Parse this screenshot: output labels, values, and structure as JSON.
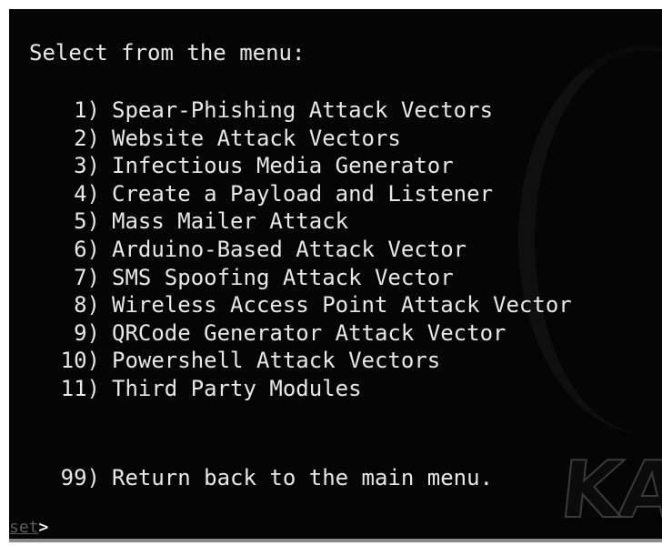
{
  "terminal": {
    "heading": "Select from the menu:",
    "menu_items": [
      {
        "number": "1)",
        "label": "Spear-Phishing Attack Vectors"
      },
      {
        "number": "2)",
        "label": "Website Attack Vectors"
      },
      {
        "number": "3)",
        "label": "Infectious Media Generator"
      },
      {
        "number": "4)",
        "label": "Create a Payload and Listener"
      },
      {
        "number": "5)",
        "label": "Mass Mailer Attack"
      },
      {
        "number": "6)",
        "label": "Arduino-Based Attack Vector"
      },
      {
        "number": "7)",
        "label": "SMS Spoofing Attack Vector"
      },
      {
        "number": "8)",
        "label": "Wireless Access Point Attack Vector"
      },
      {
        "number": "9)",
        "label": "QRCode Generator Attack Vector"
      },
      {
        "number": "10)",
        "label": "Powershell Attack Vectors"
      },
      {
        "number": "11)",
        "label": "Third Party Modules"
      }
    ],
    "return_item": {
      "number": "99)",
      "label": "Return back to the main menu."
    },
    "prompt_word": "set",
    "prompt_symbol": ">",
    "watermark_text": "KA"
  },
  "colors": {
    "background": "#050505",
    "text": "#e8e8e8",
    "prompt_word": "#5a5a5a"
  }
}
